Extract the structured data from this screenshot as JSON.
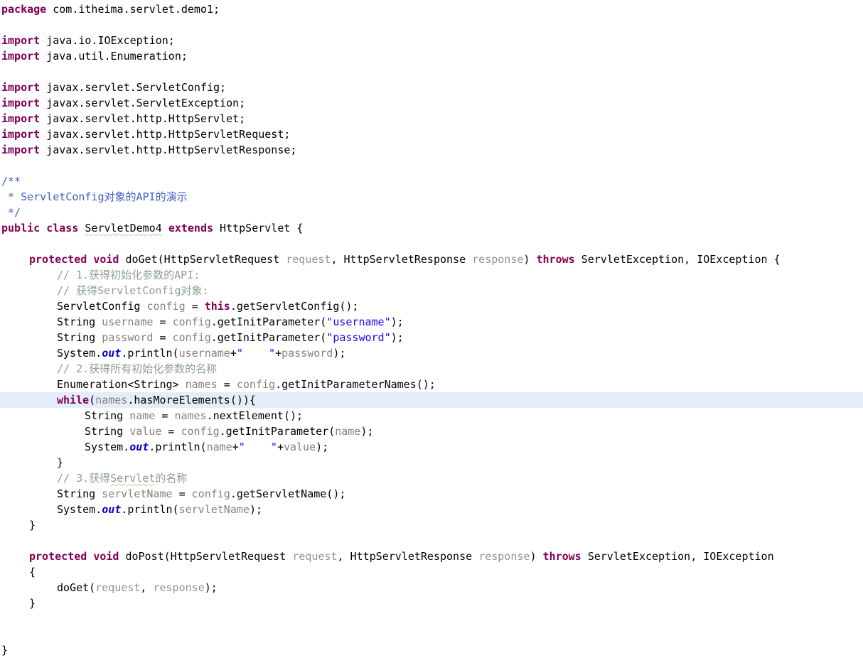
{
  "document": {
    "kind": "java-source-code",
    "language": "Java",
    "package": "com.itheima.servlet.demo1",
    "class_name": "ServletDemo4",
    "superclass": "HttpServlet",
    "current_line_number": 25,
    "colors": {
      "background": "#ffffff",
      "foreground": "#000000",
      "keyword": "#800055",
      "string": "#2a00ff",
      "comment": "#8d9e8d",
      "javadoc": "#3f5fbf",
      "local_variable": "#8a7f7a",
      "parameter": "#9b8f8a",
      "static_field": "#0000c0",
      "current_line_highlight": "#e4edfa",
      "spelling_underline": "#d8c9a8"
    },
    "lines": [
      {
        "n": 1,
        "indent": 0,
        "tokens": [
          {
            "t": "package",
            "c": "kw"
          },
          {
            "t": " com.itheima.servlet.demo1;",
            "c": "plain"
          }
        ]
      },
      {
        "n": 2,
        "indent": 0,
        "tokens": []
      },
      {
        "n": 3,
        "indent": 0,
        "tokens": [
          {
            "t": "import",
            "c": "kw"
          },
          {
            "t": " java.io.IOException;",
            "c": "plain"
          }
        ]
      },
      {
        "n": 4,
        "indent": 0,
        "tokens": [
          {
            "t": "import",
            "c": "kw"
          },
          {
            "t": " java.util.Enumeration;",
            "c": "plain"
          }
        ]
      },
      {
        "n": 5,
        "indent": 0,
        "tokens": []
      },
      {
        "n": 6,
        "indent": 0,
        "tokens": [
          {
            "t": "import",
            "c": "kw"
          },
          {
            "t": " javax.servlet.ServletConfig;",
            "c": "plain"
          }
        ]
      },
      {
        "n": 7,
        "indent": 0,
        "tokens": [
          {
            "t": "import",
            "c": "kw"
          },
          {
            "t": " javax.servlet.ServletException;",
            "c": "plain"
          }
        ]
      },
      {
        "n": 8,
        "indent": 0,
        "tokens": [
          {
            "t": "import",
            "c": "kw"
          },
          {
            "t": " javax.servlet.http.HttpServlet;",
            "c": "plain"
          }
        ]
      },
      {
        "n": 9,
        "indent": 0,
        "tokens": [
          {
            "t": "import",
            "c": "kw"
          },
          {
            "t": " javax.servlet.http.HttpServletRequest;",
            "c": "plain"
          }
        ]
      },
      {
        "n": 10,
        "indent": 0,
        "tokens": [
          {
            "t": "import",
            "c": "kw"
          },
          {
            "t": " javax.servlet.http.HttpServletResponse;",
            "c": "plain"
          }
        ]
      },
      {
        "n": 11,
        "indent": 0,
        "tokens": []
      },
      {
        "n": 12,
        "indent": 0,
        "tokens": [
          {
            "t": "/**",
            "c": "doc"
          }
        ]
      },
      {
        "n": 13,
        "indent": 0,
        "tokens": [
          {
            "t": " * ServletConfig对象的API的演示",
            "c": "doc"
          }
        ]
      },
      {
        "n": 14,
        "indent": 0,
        "tokens": [
          {
            "t": " */",
            "c": "doc"
          }
        ]
      },
      {
        "n": 15,
        "indent": 0,
        "tokens": [
          {
            "t": "public",
            "c": "kw"
          },
          {
            "t": " ",
            "c": "plain"
          },
          {
            "t": "class",
            "c": "kw"
          },
          {
            "t": " ",
            "c": "plain"
          },
          {
            "t": "ServletDemo4",
            "c": "plain",
            "spell": true
          },
          {
            "t": " ",
            "c": "plain"
          },
          {
            "t": "extends",
            "c": "kw"
          },
          {
            "t": " HttpServlet {",
            "c": "plain"
          }
        ]
      },
      {
        "n": 16,
        "indent": 0,
        "tokens": []
      },
      {
        "n": 17,
        "indent": 1,
        "tokens": [
          {
            "t": "protected",
            "c": "kw"
          },
          {
            "t": " ",
            "c": "plain"
          },
          {
            "t": "void",
            "c": "kw"
          },
          {
            "t": " doGet(HttpServletRequest ",
            "c": "plain"
          },
          {
            "t": "request",
            "c": "param"
          },
          {
            "t": ", HttpServletResponse ",
            "c": "plain"
          },
          {
            "t": "response",
            "c": "param"
          },
          {
            "t": ") ",
            "c": "plain"
          },
          {
            "t": "throws",
            "c": "kw"
          },
          {
            "t": " ServletException, IOException {",
            "c": "plain"
          }
        ]
      },
      {
        "n": 18,
        "indent": 2,
        "tokens": [
          {
            "t": "// 1.获得初始化参数的API:",
            "c": "cmt"
          }
        ]
      },
      {
        "n": 19,
        "indent": 2,
        "tokens": [
          {
            "t": "// 获得ServletConfig对象:",
            "c": "cmt"
          }
        ]
      },
      {
        "n": 20,
        "indent": 2,
        "tokens": [
          {
            "t": "ServletConfig ",
            "c": "plain"
          },
          {
            "t": "config",
            "c": "local"
          },
          {
            "t": " = ",
            "c": "plain"
          },
          {
            "t": "this",
            "c": "kw"
          },
          {
            "t": ".getServletConfig();",
            "c": "plain"
          }
        ]
      },
      {
        "n": 21,
        "indent": 2,
        "tokens": [
          {
            "t": "String ",
            "c": "plain"
          },
          {
            "t": "username",
            "c": "local"
          },
          {
            "t": " = ",
            "c": "plain"
          },
          {
            "t": "config",
            "c": "local"
          },
          {
            "t": ".getInitParameter(",
            "c": "plain"
          },
          {
            "t": "\"username\"",
            "c": "str"
          },
          {
            "t": ");",
            "c": "plain"
          }
        ]
      },
      {
        "n": 22,
        "indent": 2,
        "tokens": [
          {
            "t": "String ",
            "c": "plain"
          },
          {
            "t": "password",
            "c": "local"
          },
          {
            "t": " = ",
            "c": "plain"
          },
          {
            "t": "config",
            "c": "local"
          },
          {
            "t": ".getInitParameter(",
            "c": "plain"
          },
          {
            "t": "\"password\"",
            "c": "str"
          },
          {
            "t": ");",
            "c": "plain"
          }
        ]
      },
      {
        "n": 23,
        "indent": 2,
        "tokens": [
          {
            "t": "System.",
            "c": "plain"
          },
          {
            "t": "out",
            "c": "field"
          },
          {
            "t": ".println(",
            "c": "plain"
          },
          {
            "t": "username",
            "c": "local"
          },
          {
            "t": "+",
            "c": "plain"
          },
          {
            "t": "\"    \"",
            "c": "str"
          },
          {
            "t": "+",
            "c": "plain"
          },
          {
            "t": "password",
            "c": "local"
          },
          {
            "t": ");",
            "c": "plain"
          }
        ]
      },
      {
        "n": 24,
        "indent": 2,
        "tokens": [
          {
            "t": "// 2.获得所有初始化参数的名称",
            "c": "cmt"
          }
        ]
      },
      {
        "n": 25,
        "indent": 2,
        "tokens": [
          {
            "t": "Enumeration<String> ",
            "c": "plain"
          },
          {
            "t": "names",
            "c": "local"
          },
          {
            "t": " = ",
            "c": "plain"
          },
          {
            "t": "config",
            "c": "local"
          },
          {
            "t": ".getInitParameterNames();",
            "c": "plain"
          }
        ]
      },
      {
        "n": 26,
        "indent": 2,
        "current": true,
        "tokens": [
          {
            "t": "while",
            "c": "kw"
          },
          {
            "t": "(",
            "c": "plain"
          },
          {
            "t": "names",
            "c": "local"
          },
          {
            "t": ".hasMoreElements()){",
            "c": "plain"
          }
        ]
      },
      {
        "n": 27,
        "indent": 3,
        "tokens": [
          {
            "t": "String ",
            "c": "plain"
          },
          {
            "t": "name",
            "c": "local"
          },
          {
            "t": " = ",
            "c": "plain"
          },
          {
            "t": "names",
            "c": "local"
          },
          {
            "t": ".nextElement();",
            "c": "plain"
          }
        ]
      },
      {
        "n": 28,
        "indent": 3,
        "tokens": [
          {
            "t": "String ",
            "c": "plain"
          },
          {
            "t": "value",
            "c": "local"
          },
          {
            "t": " = ",
            "c": "plain"
          },
          {
            "t": "config",
            "c": "local"
          },
          {
            "t": ".getInitParameter(",
            "c": "plain"
          },
          {
            "t": "name",
            "c": "local"
          },
          {
            "t": ");",
            "c": "plain"
          }
        ]
      },
      {
        "n": 29,
        "indent": 3,
        "tokens": [
          {
            "t": "System.",
            "c": "plain"
          },
          {
            "t": "out",
            "c": "field"
          },
          {
            "t": ".println(",
            "c": "plain"
          },
          {
            "t": "name",
            "c": "local"
          },
          {
            "t": "+",
            "c": "plain"
          },
          {
            "t": "\"    \"",
            "c": "str"
          },
          {
            "t": "+",
            "c": "plain"
          },
          {
            "t": "value",
            "c": "local"
          },
          {
            "t": ");",
            "c": "plain"
          }
        ]
      },
      {
        "n": 30,
        "indent": 2,
        "tokens": [
          {
            "t": "}",
            "c": "plain"
          }
        ]
      },
      {
        "n": 31,
        "indent": 2,
        "tokens": [
          {
            "t": "// 3.获得",
            "c": "cmt"
          },
          {
            "t": "Servlet",
            "c": "cmt",
            "spell": true
          },
          {
            "t": "的名称",
            "c": "cmt"
          }
        ]
      },
      {
        "n": 32,
        "indent": 2,
        "tokens": [
          {
            "t": "String ",
            "c": "plain"
          },
          {
            "t": "servletName",
            "c": "local"
          },
          {
            "t": " = ",
            "c": "plain"
          },
          {
            "t": "config",
            "c": "local"
          },
          {
            "t": ".getServletName();",
            "c": "plain"
          }
        ]
      },
      {
        "n": 33,
        "indent": 2,
        "tokens": [
          {
            "t": "System.",
            "c": "plain"
          },
          {
            "t": "out",
            "c": "field"
          },
          {
            "t": ".println(",
            "c": "plain"
          },
          {
            "t": "servletName",
            "c": "local"
          },
          {
            "t": ");",
            "c": "plain"
          }
        ]
      },
      {
        "n": 34,
        "indent": 1,
        "tokens": [
          {
            "t": "}",
            "c": "plain"
          }
        ]
      },
      {
        "n": 35,
        "indent": 0,
        "tokens": []
      },
      {
        "n": 36,
        "indent": 1,
        "tokens": [
          {
            "t": "protected",
            "c": "kw"
          },
          {
            "t": " ",
            "c": "plain"
          },
          {
            "t": "void",
            "c": "kw"
          },
          {
            "t": " doPost(HttpServletRequest ",
            "c": "plain"
          },
          {
            "t": "request",
            "c": "param"
          },
          {
            "t": ", HttpServletResponse ",
            "c": "plain"
          },
          {
            "t": "response",
            "c": "param"
          },
          {
            "t": ") ",
            "c": "plain"
          },
          {
            "t": "throws",
            "c": "kw"
          },
          {
            "t": " ServletException, IOException",
            "c": "plain"
          }
        ]
      },
      {
        "n": 37,
        "indent": 1,
        "tokens": [
          {
            "t": "{",
            "c": "plain"
          }
        ]
      },
      {
        "n": 38,
        "indent": 2,
        "tokens": [
          {
            "t": "doGet(",
            "c": "plain"
          },
          {
            "t": "request",
            "c": "param"
          },
          {
            "t": ", ",
            "c": "plain"
          },
          {
            "t": "response",
            "c": "param"
          },
          {
            "t": ");",
            "c": "plain"
          }
        ]
      },
      {
        "n": 39,
        "indent": 1,
        "tokens": [
          {
            "t": "}",
            "c": "plain"
          }
        ]
      },
      {
        "n": 40,
        "indent": 0,
        "tokens": []
      },
      {
        "n": 41,
        "indent": 0,
        "tokens": []
      },
      {
        "n": 42,
        "indent": 0,
        "tokens": [
          {
            "t": "}",
            "c": "plain"
          }
        ]
      }
    ]
  }
}
